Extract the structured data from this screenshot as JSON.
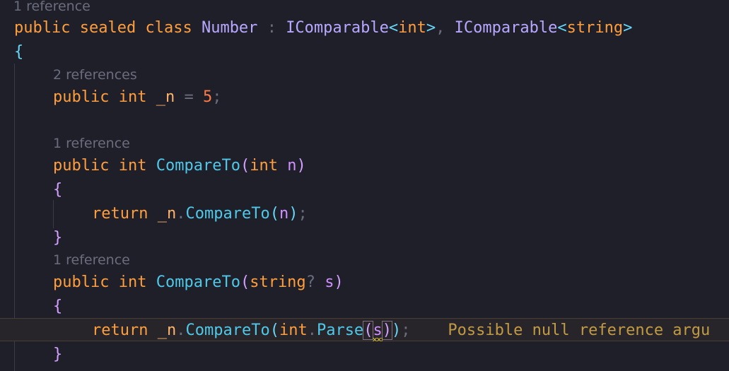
{
  "codelens": {
    "class": "1 reference",
    "field": "2 references",
    "method1": "1 reference",
    "method2": "1 reference"
  },
  "code": {
    "public": "public",
    "sealed": "sealed",
    "class": "class",
    "classname": "Number",
    "colon": ":",
    "icomparable": "IComparable",
    "lt": "<",
    "gt": ">",
    "int": "int",
    "string": "string",
    "comma": ",",
    "open_brace": "{",
    "close_brace": "}",
    "field_name": "_n",
    "eq": "=",
    "five": "5",
    "semicolon": ";",
    "compareto": "CompareTo",
    "open_paren": "(",
    "close_paren": ")",
    "n": "n",
    "return": "return",
    "dot": ".",
    "nullable": "?",
    "s": "s",
    "parse": "Parse"
  },
  "inline_diagnostic": "Possible null reference argu",
  "colors": {
    "background": "#1f1f2a",
    "keyword": "#ff9e3d",
    "type": "#50c8e8",
    "class": "#b8a8ff",
    "bracket": "#d3a0ff",
    "number": "#ff7a45",
    "field": "#ffb36b",
    "parameter": "#d08fff",
    "hint": "#6b6d7c",
    "warning": "#c29a44"
  }
}
